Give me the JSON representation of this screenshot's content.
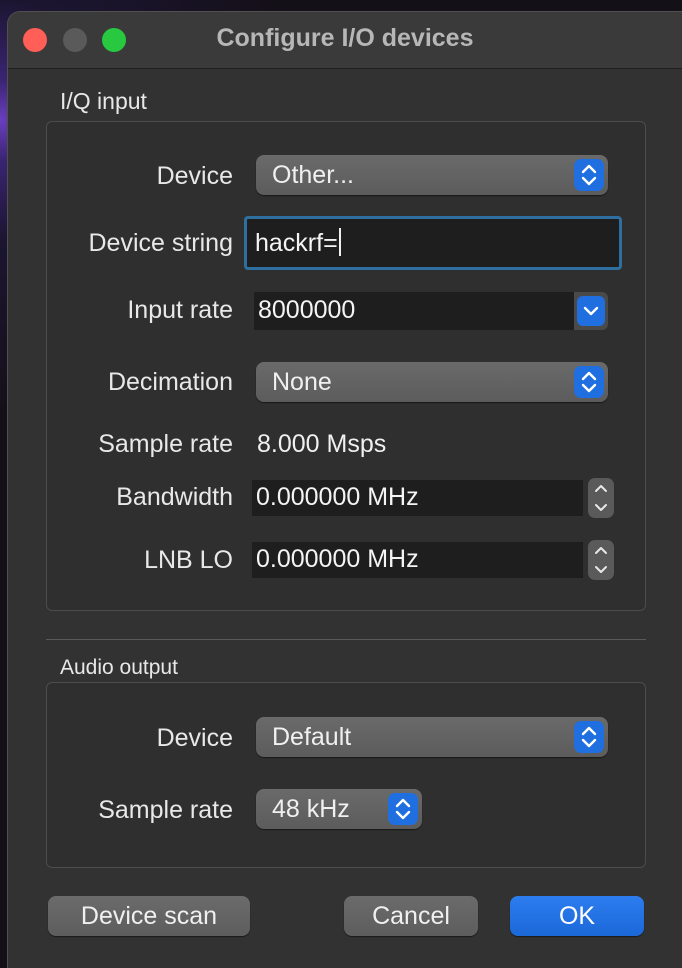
{
  "window": {
    "title": "Configure I/O devices"
  },
  "iq_input": {
    "section_label": "I/Q input",
    "device": {
      "label": "Device",
      "value": "Other..."
    },
    "device_string": {
      "label": "Device string",
      "value": "hackrf="
    },
    "input_rate": {
      "label": "Input rate",
      "value": "8000000"
    },
    "decimation": {
      "label": "Decimation",
      "value": "None"
    },
    "sample_rate": {
      "label": "Sample rate",
      "value": "8.000 Msps"
    },
    "bandwidth": {
      "label": "Bandwidth",
      "value": "0.000000 MHz"
    },
    "lnb_lo": {
      "label": "LNB LO",
      "value": "0.000000 MHz"
    }
  },
  "audio_output": {
    "section_label": "Audio output",
    "device": {
      "label": "Device",
      "value": "Default"
    },
    "sample_rate": {
      "label": "Sample rate",
      "value": "48 kHz"
    }
  },
  "buttons": {
    "device_scan": "Device scan",
    "cancel": "Cancel",
    "ok": "OK"
  },
  "colors": {
    "accent": "#1f6fe0",
    "window_bg": "#323232",
    "close": "#ff5f57",
    "maximize": "#28c840"
  },
  "icons": {
    "combo_arrows": "chevron-up-down-icon",
    "dropdown": "chevron-down-icon",
    "stepper_up": "chevron-up-icon",
    "stepper_down": "chevron-down-icon"
  }
}
